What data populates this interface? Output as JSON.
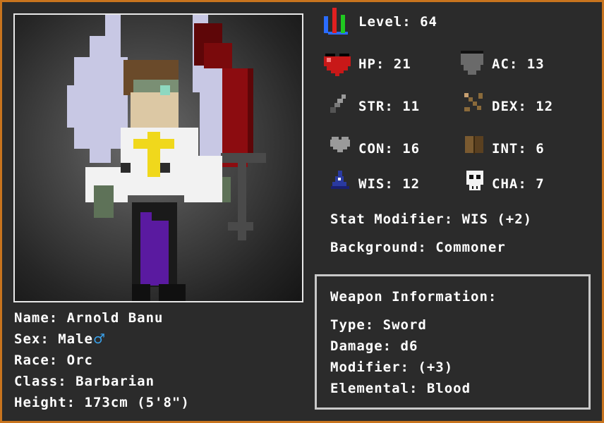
{
  "character": {
    "name_line": "Name: Arnold Banu",
    "sex_line": "Sex: Male",
    "sex_symbol": "♂",
    "race_line": "Race: Orc",
    "class_line": "Class: Barbarian",
    "height_line": "Height: 173cm (5'8\")"
  },
  "stats": {
    "level": "Level: 64",
    "hp": "HP: 21",
    "ac": "AC: 13",
    "str": "STR: 11",
    "dex": "DEX: 12",
    "con": "CON: 16",
    "int": "INT: 6",
    "wis": "WIS: 12",
    "cha": "CHA: 7",
    "stat_modifier": "Stat Modifier: WIS (+2)",
    "background": "Background: Commoner"
  },
  "weapon": {
    "header": "Weapon Information:",
    "type": "Type: Sword",
    "damage": "Damage: d6",
    "modifier": "Modifier: (+3)",
    "elemental": "Elemental: Blood"
  },
  "colors": {
    "frame": "#c8741e",
    "panel_bg": "#2b2b2b",
    "text": "#ffffff",
    "male_symbol": "#3aa0e8"
  },
  "icons": [
    "level-bars-icon",
    "heart-icon",
    "shield-icon",
    "sword-icon",
    "bow-icon",
    "grey-heart-icon",
    "book-icon",
    "wizard-hat-icon",
    "skull-icon"
  ]
}
